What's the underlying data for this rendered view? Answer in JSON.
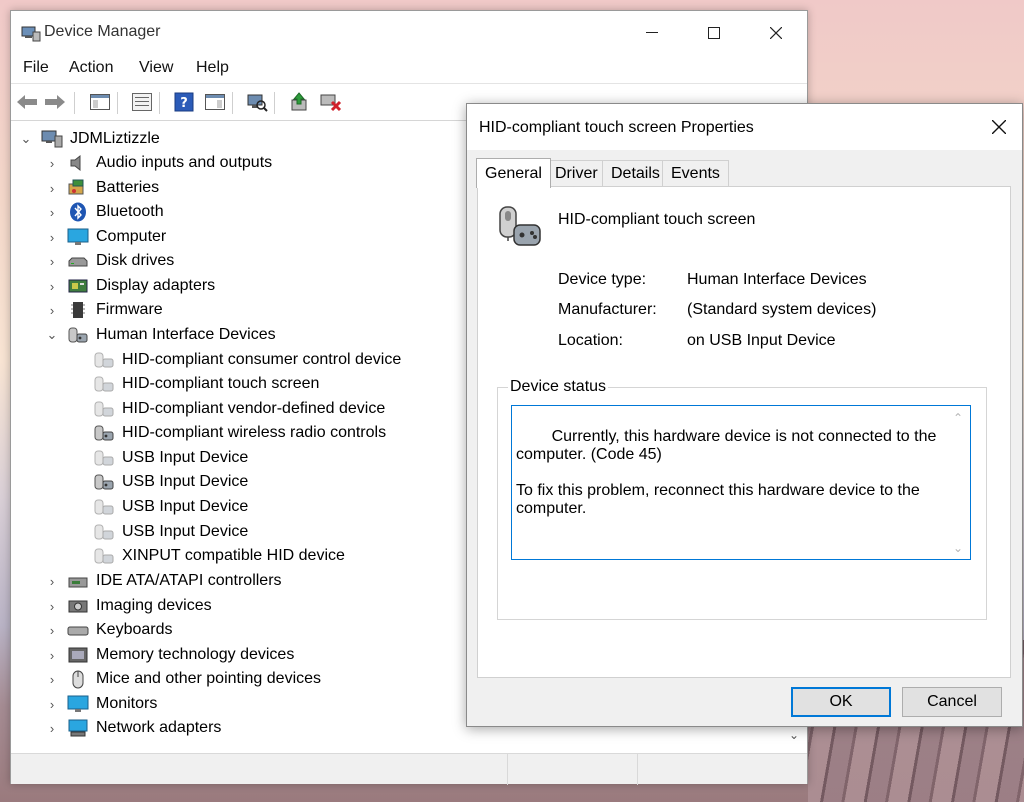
{
  "device_manager": {
    "title": "Device Manager",
    "menu": [
      "File",
      "Action",
      "View",
      "Help"
    ],
    "tree": {
      "root": "JDMLiztizzle",
      "categories": [
        {
          "label": "Audio inputs and outputs",
          "icon": "speaker-icon"
        },
        {
          "label": "Batteries",
          "icon": "battery-icon"
        },
        {
          "label": "Bluetooth",
          "icon": "bluetooth-icon"
        },
        {
          "label": "Computer",
          "icon": "monitor-icon"
        },
        {
          "label": "Disk drives",
          "icon": "disk-drive-icon"
        },
        {
          "label": "Display adapters",
          "icon": "display-adapter-icon"
        },
        {
          "label": "Firmware",
          "icon": "firmware-icon"
        },
        {
          "label": "Human Interface Devices",
          "icon": "hid-icon",
          "expanded": true
        },
        {
          "label": "IDE ATA/ATAPI controllers",
          "icon": "ide-controller-icon"
        },
        {
          "label": "Imaging devices",
          "icon": "camera-icon"
        },
        {
          "label": "Keyboards",
          "icon": "keyboard-icon"
        },
        {
          "label": "Memory technology devices",
          "icon": "memory-icon"
        },
        {
          "label": "Mice and other pointing devices",
          "icon": "mouse-icon"
        },
        {
          "label": "Monitors",
          "icon": "monitor-icon"
        },
        {
          "label": "Network adapters",
          "icon": "network-adapter-icon"
        }
      ],
      "hid_children": [
        {
          "label": "HID-compliant consumer control device",
          "disabled": true
        },
        {
          "label": "HID-compliant touch screen",
          "disabled": true
        },
        {
          "label": "HID-compliant vendor-defined device",
          "disabled": true
        },
        {
          "label": "HID-compliant wireless radio controls",
          "disabled": false
        },
        {
          "label": "USB Input Device",
          "disabled": true
        },
        {
          "label": "USB Input Device",
          "disabled": false
        },
        {
          "label": "USB Input Device",
          "disabled": true
        },
        {
          "label": "USB Input Device",
          "disabled": true
        },
        {
          "label": "XINPUT compatible HID device",
          "disabled": true
        }
      ]
    }
  },
  "properties_dialog": {
    "title": "HID-compliant touch screen Properties",
    "tabs": [
      "General",
      "Driver",
      "Details",
      "Events"
    ],
    "active_tab": "General",
    "device_name": "HID-compliant touch screen",
    "properties": [
      {
        "label": "Device type:",
        "value": "Human Interface Devices"
      },
      {
        "label": "Manufacturer:",
        "value": "(Standard system devices)"
      },
      {
        "label": "Location:",
        "value": "on USB Input Device"
      }
    ],
    "status_group_label": "Device status",
    "status_text": "Currently, this hardware device is not connected to the computer. (Code 45)\n\nTo fix this problem, reconnect this hardware device to the computer.",
    "ok_label": "OK",
    "cancel_label": "Cancel"
  },
  "colors": {
    "accent": "#0078d7"
  }
}
